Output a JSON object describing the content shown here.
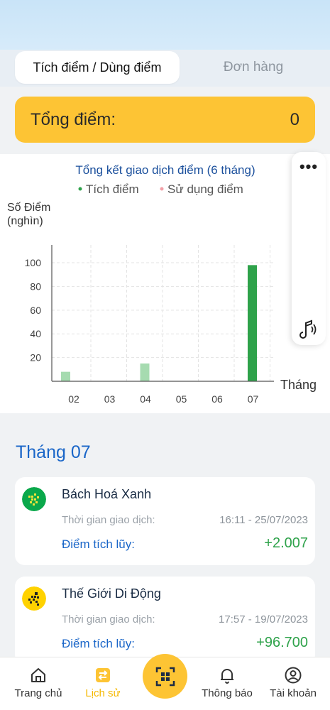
{
  "tabs": {
    "active_label": "Tích điểm / Dùng điểm",
    "other_label": "Đơn hàng"
  },
  "total": {
    "label": "Tổng điểm:",
    "value": "0"
  },
  "chart_data": {
    "type": "bar",
    "title": "Tổng kết giao dịch điểm (6 tháng)",
    "legend": [
      {
        "name": "Tích điểm",
        "color": "#2ea24a"
      },
      {
        "name": "Sử dụng điểm",
        "color": "#f2a0a8"
      }
    ],
    "ylabel_line1": "Số Điểm",
    "ylabel_line2": "(nghìn)",
    "xlabel": "Tháng",
    "categories": [
      "02",
      "03",
      "04",
      "05",
      "06",
      "07"
    ],
    "series": [
      {
        "name": "Tích điểm",
        "values": [
          8,
          0,
          15,
          0,
          0,
          98
        ]
      }
    ],
    "yticks": [
      20,
      40,
      60,
      80,
      100
    ],
    "ylim": [
      0,
      115
    ],
    "bar_colors": [
      "#a6dbb0",
      "#a6dbb0",
      "#a6dbb0",
      "#a6dbb0",
      "#a6dbb0",
      "#2ea24a"
    ],
    "grid": true
  },
  "float_panel": {
    "menu_icon": "more-dots-icon",
    "audio_icon": "speaker-icon"
  },
  "month_section": {
    "title": "Tháng 07"
  },
  "transactions": [
    {
      "name": "Bách Hoá Xanh",
      "time_label": "Thời gian giao dịch:",
      "time": "16:11 - 25/07/2023",
      "points_label": "Điểm tích lũy:",
      "points": "+2.007",
      "logo_color": "#0aa84b"
    },
    {
      "name": "Thế Giới Di Động",
      "time_label": "Thời gian giao dịch:",
      "time": "17:57 - 19/07/2023",
      "points_label": "Điểm tích lũy:",
      "points": "+96.700",
      "logo_color": "#ffd200"
    }
  ],
  "nav": {
    "home": "Trang chủ",
    "history": "Lịch sử",
    "notifications": "Thông báo",
    "account": "Tài khoản"
  }
}
